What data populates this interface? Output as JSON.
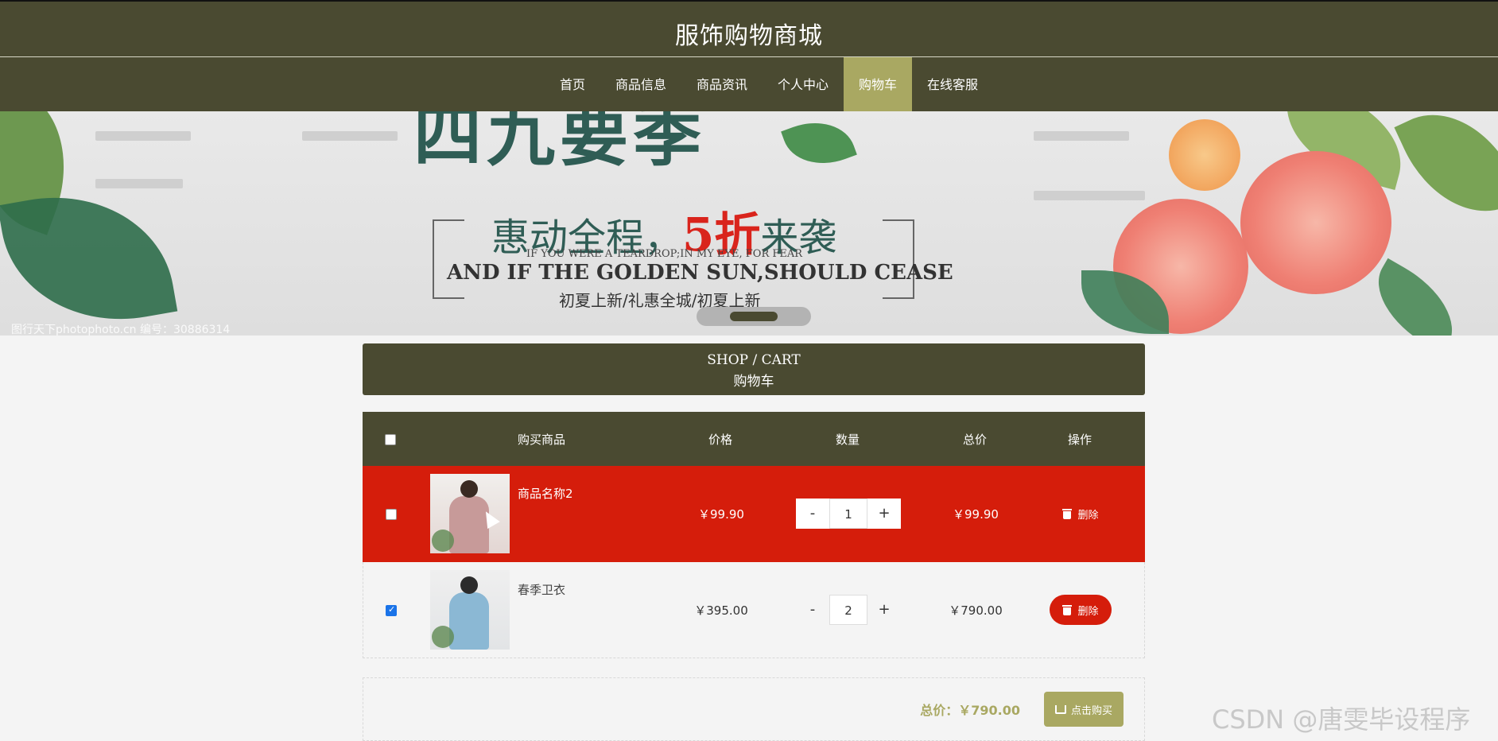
{
  "site": {
    "title": "服饰购物商城"
  },
  "nav": {
    "items": [
      {
        "label": "首页"
      },
      {
        "label": "商品信息"
      },
      {
        "label": "商品资讯"
      },
      {
        "label": "个人中心"
      },
      {
        "label": "购物车"
      },
      {
        "label": "在线客服"
      }
    ],
    "active_index": 4,
    "active_color": "#a9a862"
  },
  "banner": {
    "top_text": "四九要季",
    "line1_part1": "惠动全程，",
    "line1_highlight": "5折",
    "line1_part2": "来袭",
    "line2": "IF YOU WERE A TEARDROP;IN MY EYE, FOR FEAR",
    "line3": "AND IF THE GOLDEN SUN,SHOULD CEASE",
    "line4": "初夏上新/礼惠全城/初夏上新",
    "watermark": "图行天下photophoto.cn  编号：30886314"
  },
  "cart": {
    "title_en": "SHOP / CART",
    "title_cn": "购物车",
    "columns": [
      "购买商品",
      "价格",
      "数量",
      "总价",
      "操作"
    ],
    "items": [
      {
        "name": "商品名称2",
        "price": "￥99.90",
        "quantity": "1",
        "total": "￥99.90",
        "checked": false,
        "delete_label": "删除"
      },
      {
        "name": "春季卫衣",
        "price": "￥395.00",
        "quantity": "2",
        "total": "￥790.00",
        "checked": true,
        "delete_label": "删除"
      }
    ],
    "qty_minus": "-",
    "qty_plus": "+",
    "sum_label": "总价：￥790.00",
    "buy_label": "点击购买"
  },
  "watermark": "CSDN @唐雯毕设程序",
  "colors": {
    "header_bg": "#4a4a31",
    "accent": "#a9a862",
    "danger": "#d51d0b"
  }
}
